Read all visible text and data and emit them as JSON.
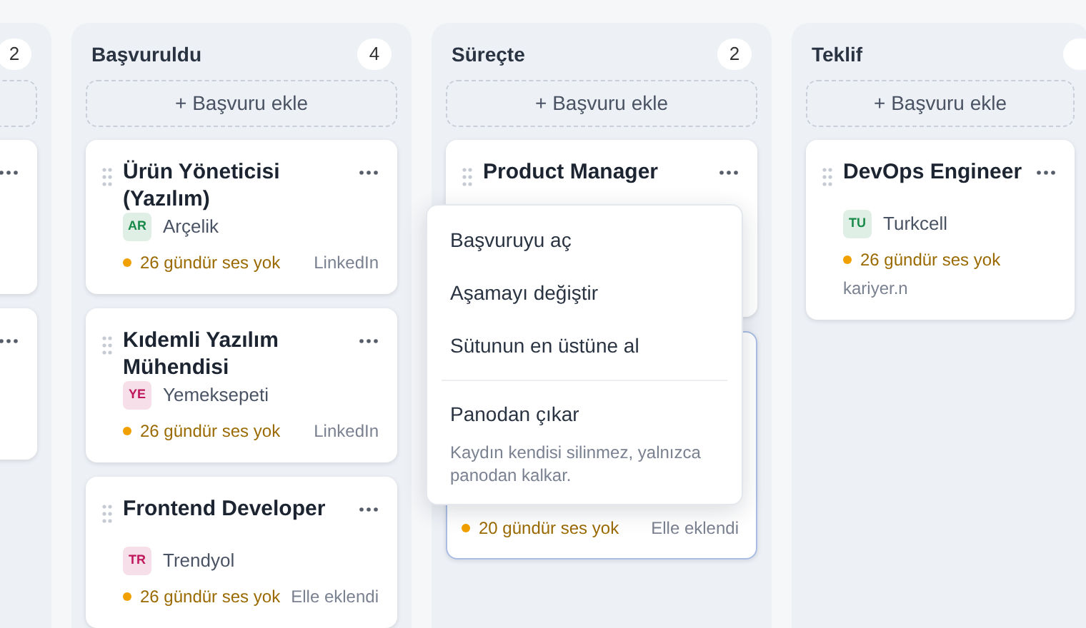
{
  "columns": [
    {
      "count": "2",
      "cards": [
        {
          "kind": "cut"
        },
        {
          "kind": "cut"
        }
      ]
    },
    {
      "title": "Başvuruldu",
      "count": "4",
      "add_label": "+ Başvuru ekle",
      "cards": [
        {
          "title": "Ürün Yöneticisi (Yazılım)",
          "company": {
            "initials": "AR",
            "name": "Arçelik",
            "color": "#1a8a4a"
          },
          "status": "26 gündür ses yok",
          "source": "LinkedIn",
          "highlighted": false
        },
        {
          "title": "Kıdemli Yazılım Mühendisi",
          "company": {
            "initials": "YE",
            "name": "Yemeksepeti",
            "color": "#c0185c"
          },
          "status": "26 gündür ses yok",
          "source": "LinkedIn",
          "highlighted": false
        },
        {
          "title": "Frontend Developer",
          "company": {
            "initials": "TR",
            "name": "Trendyol",
            "color": "#c0185c"
          },
          "status": "26 gündür ses yok",
          "source": "Elle eklendi",
          "highlighted": false
        }
      ]
    },
    {
      "title": "Süreçte",
      "count": "2",
      "add_label": "+ Başvuru ekle",
      "cards": [
        {
          "title": "Product Manager",
          "highlighted": false
        },
        {
          "status": "20 gündür ses yok",
          "source": "Elle eklendi",
          "highlighted": true
        }
      ],
      "menu": {
        "items": [
          {
            "label": "Başvuruyu aç"
          },
          {
            "label": "Aşamayı değiştir"
          },
          {
            "label": "Sütunun en üstüne al"
          },
          {
            "label": "Panodan çıkar",
            "description": "Kaydın kendisi silinmez, yalnızca panodan kalkar.",
            "separated": true
          }
        ]
      }
    },
    {
      "title": "Teklif",
      "add_label": "+ Başvuru ekle",
      "cards": [
        {
          "title": "DevOps Engineer",
          "company": {
            "initials": "TU",
            "name": "Turkcell",
            "color": "#1a8a4a"
          },
          "status": "26 gündür ses yok",
          "source": "kariyer.n",
          "highlighted": false
        }
      ]
    }
  ]
}
